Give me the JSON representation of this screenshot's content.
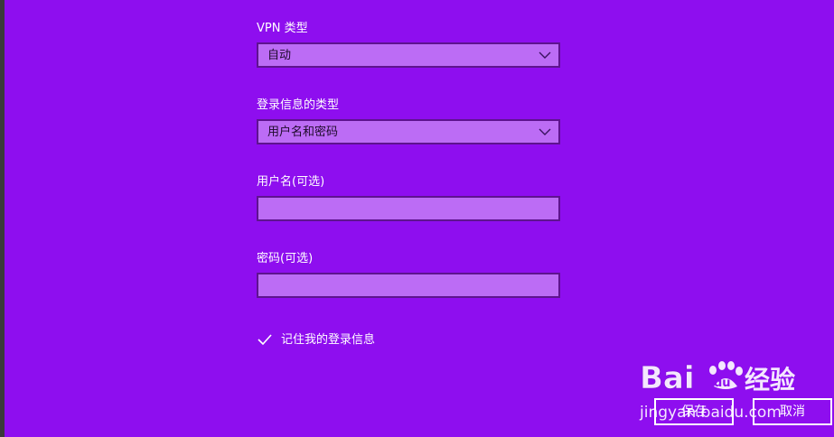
{
  "vpn_type": {
    "label": "VPN 类型",
    "selected": "自动",
    "icon": "chevron-down-icon"
  },
  "login_type": {
    "label": "登录信息的类型",
    "selected": "用户名和密码",
    "icon": "chevron-down-icon"
  },
  "username": {
    "label": "用户名(可选)",
    "value": ""
  },
  "password": {
    "label": "密码(可选)",
    "value": ""
  },
  "remember": {
    "label": "记住我的登录信息",
    "checked": true,
    "icon": "check-icon"
  },
  "buttons": {
    "save": "保存",
    "cancel": "取消"
  },
  "watermark": {
    "brand": "Baidu经验",
    "domain": "jingyan.baidu.com"
  },
  "colors": {
    "background": "#8E0EEF",
    "field_fill": "#BC6CF5",
    "field_border": "#5E138F"
  }
}
